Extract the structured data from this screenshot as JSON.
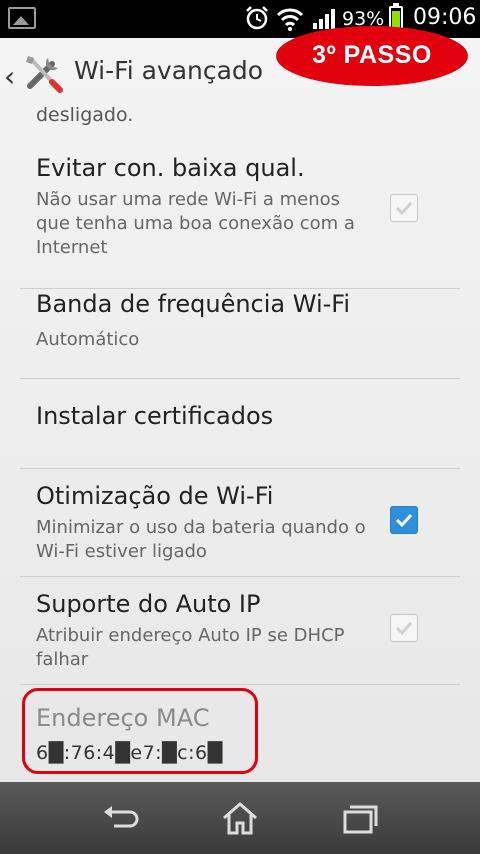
{
  "status_bar": {
    "battery_percent": "93%",
    "time": "09:06",
    "icons": [
      "picture-icon",
      "alarm-icon",
      "wifi-icon",
      "signal-icon",
      "battery-icon"
    ]
  },
  "action_bar": {
    "title": "Wi-Fi avançado",
    "icon": "tools-icon"
  },
  "annotation": {
    "step_label": "3º PASSO",
    "color": "#e2000f"
  },
  "settings": {
    "partial_text": "desligado.",
    "items": [
      {
        "title": "Evitar con. baixa qual.",
        "subtitle": "Não usar uma rede Wi-Fi a menos que tenha uma boa conexão com a Internet",
        "checkbox": "disabled-checked"
      },
      {
        "title": "Banda de frequência Wi-Fi",
        "subtitle": "Automático"
      },
      {
        "title": "Instalar certificados"
      },
      {
        "title": "Otimização de Wi-Fi",
        "subtitle": "Minimizar o uso da bateria quando o Wi-Fi estiver ligado",
        "checkbox": "checked"
      },
      {
        "title": "Suporte do Auto IP",
        "subtitle": "Atribuir endereço Auto IP se DHCP falhar",
        "checkbox": "disabled-checked"
      },
      {
        "title": "Endereço MAC",
        "value": "6█:76:4█e7:█c:6█"
      }
    ]
  },
  "nav_bar": {
    "buttons": [
      "back-icon",
      "home-icon",
      "recent-apps-icon"
    ]
  },
  "colors": {
    "accent": "#2f8fd8",
    "annotation_red": "#e2000f",
    "battery_green": "#8ee000"
  }
}
